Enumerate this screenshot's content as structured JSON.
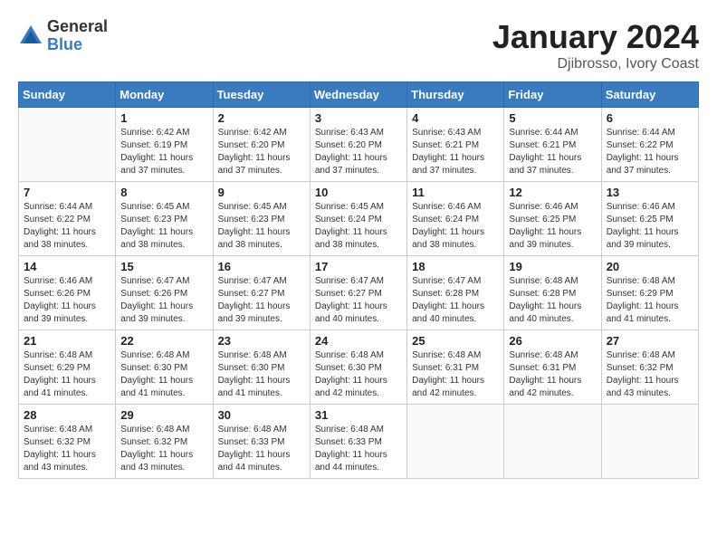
{
  "header": {
    "logo_general": "General",
    "logo_blue": "Blue",
    "month_year": "January 2024",
    "location": "Djibrosso, Ivory Coast"
  },
  "weekdays": [
    "Sunday",
    "Monday",
    "Tuesday",
    "Wednesday",
    "Thursday",
    "Friday",
    "Saturday"
  ],
  "weeks": [
    [
      {
        "day": "",
        "info": ""
      },
      {
        "day": "1",
        "info": "Sunrise: 6:42 AM\nSunset: 6:19 PM\nDaylight: 11 hours\nand 37 minutes."
      },
      {
        "day": "2",
        "info": "Sunrise: 6:42 AM\nSunset: 6:20 PM\nDaylight: 11 hours\nand 37 minutes."
      },
      {
        "day": "3",
        "info": "Sunrise: 6:43 AM\nSunset: 6:20 PM\nDaylight: 11 hours\nand 37 minutes."
      },
      {
        "day": "4",
        "info": "Sunrise: 6:43 AM\nSunset: 6:21 PM\nDaylight: 11 hours\nand 37 minutes."
      },
      {
        "day": "5",
        "info": "Sunrise: 6:44 AM\nSunset: 6:21 PM\nDaylight: 11 hours\nand 37 minutes."
      },
      {
        "day": "6",
        "info": "Sunrise: 6:44 AM\nSunset: 6:22 PM\nDaylight: 11 hours\nand 37 minutes."
      }
    ],
    [
      {
        "day": "7",
        "info": "Sunrise: 6:44 AM\nSunset: 6:22 PM\nDaylight: 11 hours\nand 38 minutes."
      },
      {
        "day": "8",
        "info": "Sunrise: 6:45 AM\nSunset: 6:23 PM\nDaylight: 11 hours\nand 38 minutes."
      },
      {
        "day": "9",
        "info": "Sunrise: 6:45 AM\nSunset: 6:23 PM\nDaylight: 11 hours\nand 38 minutes."
      },
      {
        "day": "10",
        "info": "Sunrise: 6:45 AM\nSunset: 6:24 PM\nDaylight: 11 hours\nand 38 minutes."
      },
      {
        "day": "11",
        "info": "Sunrise: 6:46 AM\nSunset: 6:24 PM\nDaylight: 11 hours\nand 38 minutes."
      },
      {
        "day": "12",
        "info": "Sunrise: 6:46 AM\nSunset: 6:25 PM\nDaylight: 11 hours\nand 39 minutes."
      },
      {
        "day": "13",
        "info": "Sunrise: 6:46 AM\nSunset: 6:25 PM\nDaylight: 11 hours\nand 39 minutes."
      }
    ],
    [
      {
        "day": "14",
        "info": "Sunrise: 6:46 AM\nSunset: 6:26 PM\nDaylight: 11 hours\nand 39 minutes."
      },
      {
        "day": "15",
        "info": "Sunrise: 6:47 AM\nSunset: 6:26 PM\nDaylight: 11 hours\nand 39 minutes."
      },
      {
        "day": "16",
        "info": "Sunrise: 6:47 AM\nSunset: 6:27 PM\nDaylight: 11 hours\nand 39 minutes."
      },
      {
        "day": "17",
        "info": "Sunrise: 6:47 AM\nSunset: 6:27 PM\nDaylight: 11 hours\nand 40 minutes."
      },
      {
        "day": "18",
        "info": "Sunrise: 6:47 AM\nSunset: 6:28 PM\nDaylight: 11 hours\nand 40 minutes."
      },
      {
        "day": "19",
        "info": "Sunrise: 6:48 AM\nSunset: 6:28 PM\nDaylight: 11 hours\nand 40 minutes."
      },
      {
        "day": "20",
        "info": "Sunrise: 6:48 AM\nSunset: 6:29 PM\nDaylight: 11 hours\nand 41 minutes."
      }
    ],
    [
      {
        "day": "21",
        "info": "Sunrise: 6:48 AM\nSunset: 6:29 PM\nDaylight: 11 hours\nand 41 minutes."
      },
      {
        "day": "22",
        "info": "Sunrise: 6:48 AM\nSunset: 6:30 PM\nDaylight: 11 hours\nand 41 minutes."
      },
      {
        "day": "23",
        "info": "Sunrise: 6:48 AM\nSunset: 6:30 PM\nDaylight: 11 hours\nand 41 minutes."
      },
      {
        "day": "24",
        "info": "Sunrise: 6:48 AM\nSunset: 6:30 PM\nDaylight: 11 hours\nand 42 minutes."
      },
      {
        "day": "25",
        "info": "Sunrise: 6:48 AM\nSunset: 6:31 PM\nDaylight: 11 hours\nand 42 minutes."
      },
      {
        "day": "26",
        "info": "Sunrise: 6:48 AM\nSunset: 6:31 PM\nDaylight: 11 hours\nand 42 minutes."
      },
      {
        "day": "27",
        "info": "Sunrise: 6:48 AM\nSunset: 6:32 PM\nDaylight: 11 hours\nand 43 minutes."
      }
    ],
    [
      {
        "day": "28",
        "info": "Sunrise: 6:48 AM\nSunset: 6:32 PM\nDaylight: 11 hours\nand 43 minutes."
      },
      {
        "day": "29",
        "info": "Sunrise: 6:48 AM\nSunset: 6:32 PM\nDaylight: 11 hours\nand 43 minutes."
      },
      {
        "day": "30",
        "info": "Sunrise: 6:48 AM\nSunset: 6:33 PM\nDaylight: 11 hours\nand 44 minutes."
      },
      {
        "day": "31",
        "info": "Sunrise: 6:48 AM\nSunset: 6:33 PM\nDaylight: 11 hours\nand 44 minutes."
      },
      {
        "day": "",
        "info": ""
      },
      {
        "day": "",
        "info": ""
      },
      {
        "day": "",
        "info": ""
      }
    ]
  ]
}
